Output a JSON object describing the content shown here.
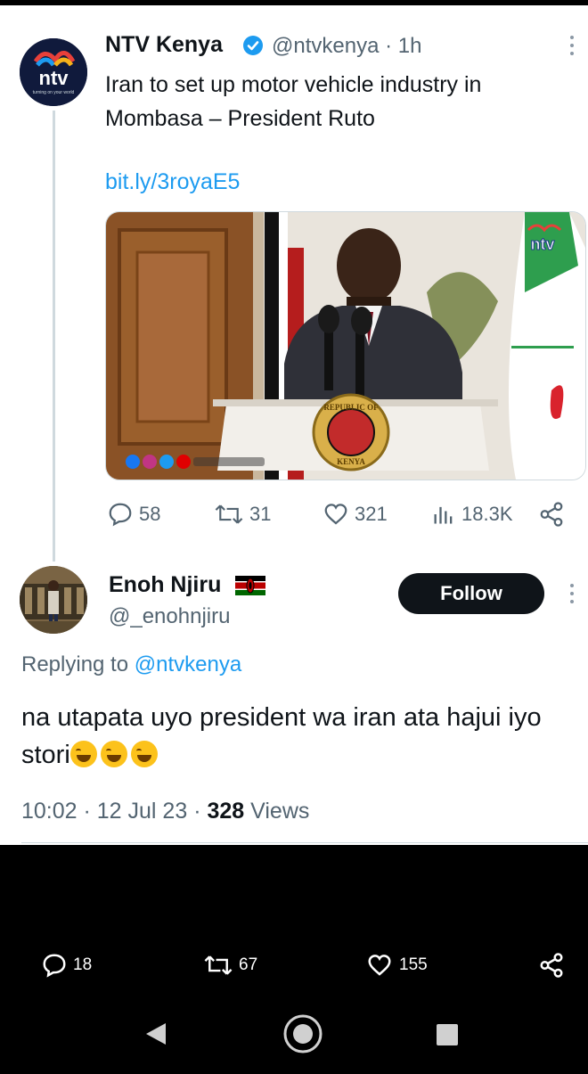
{
  "tweet": {
    "author_name": "NTV Kenya",
    "handle_time": "@ntvkenya · 1h",
    "text": "Iran to set up motor vehicle industry in Mombasa – President Ruto",
    "link": "bit.ly/3royaE5",
    "avatar_text": "ntv",
    "avatar_tagline": "turning on your world",
    "media_watermark": "ntv",
    "podium_text_top": "REPUBLIC OF",
    "podium_text_bottom": "KENYA",
    "actions": {
      "replies": "58",
      "retweets": "31",
      "likes": "321",
      "views": "18.3K"
    }
  },
  "reply": {
    "author_name": "Enoh Njiru",
    "handle": "@_enohnjiru",
    "follow_label": "Follow",
    "replying_prefix": "Replying to",
    "replying_to": "@ntvkenya",
    "text": "na utapata uyo president wa iran ata hajui iyo stori",
    "time_date": "10:02 · 12 Jul 23 · ",
    "views_count": "328",
    "views_label": " Views",
    "actions": {
      "replies": "18",
      "retweets": "67",
      "likes": "155"
    }
  },
  "icons": {
    "verified": "verified-badge-icon",
    "reply": "speech-bubble-icon",
    "retweet": "retweet-icon",
    "like": "heart-icon",
    "views": "bar-chart-icon",
    "share": "share-icon",
    "more": "more-vertical-icon",
    "flag": "kenya-flag-icon",
    "nav_back": "triangle-back-icon",
    "nav_home": "circle-home-icon",
    "nav_recent": "square-recent-icon"
  },
  "colors": {
    "accent": "#1d9bf0",
    "text": "#0f1419",
    "muted": "#536471",
    "follow_bg": "#0f1419"
  }
}
